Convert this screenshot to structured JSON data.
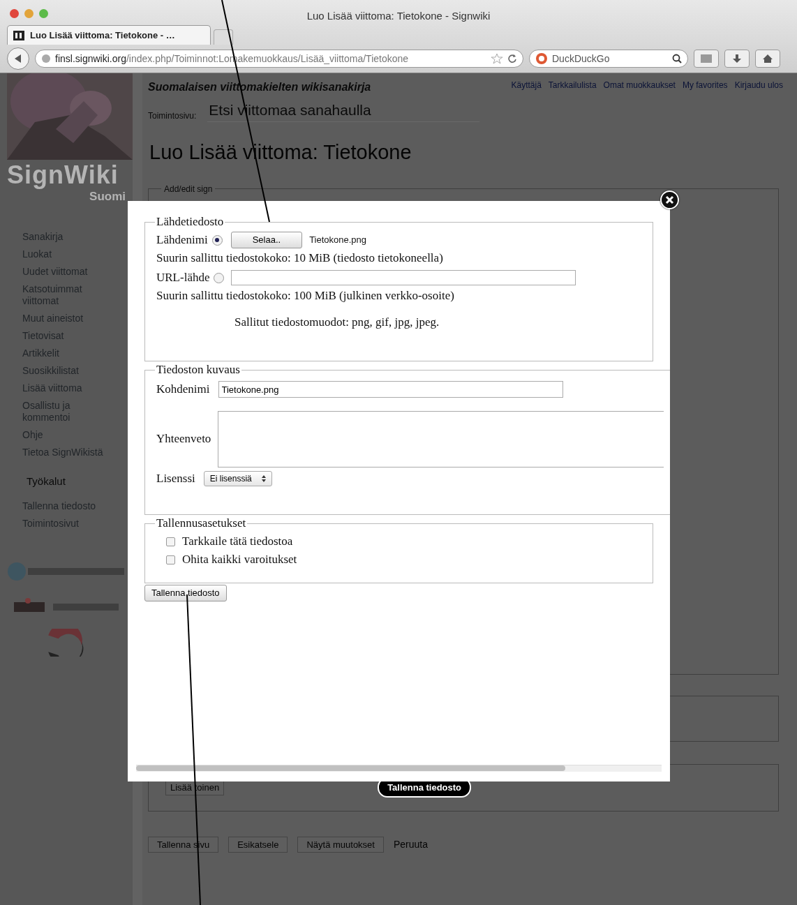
{
  "window": {
    "title": "Luo Lisää viittoma: Tietokone - Signwiki"
  },
  "tabs": [
    {
      "label": "Luo Lisää viittoma: Tietokone - …",
      "selected": true
    }
  ],
  "address_bar": {
    "domain": "finsl.signwiki.org",
    "path": "/index.php/Toiminnot:Lomakemuokkaus/Lisää_viittoma/Tietokone"
  },
  "search_bar": {
    "placeholder": "DuckDuckGo"
  },
  "site": {
    "logo_text": "SignWiki",
    "logo_subtext": "Suomi",
    "tagline": "Suomalaisen viittomakielten wikisanakirja",
    "user_links": [
      "Käyttäjä",
      "Tarkkailulista",
      "Omat muokkaukset",
      "My favorites",
      "Kirjaudu ulos"
    ],
    "search_label": "Toimintosivu:",
    "search_placeholder": "Etsi viittomaa sanahaulla"
  },
  "sidebar": {
    "items": [
      "Sanakirja",
      "Luokat",
      "Uudet viittomat",
      "Katsotuimmat viittomat",
      "Muut aineistot",
      "Tietovisat",
      "Artikkelit",
      "Suosikkilistat",
      "Lisää viittoma",
      "Osallistu ja kommentoi",
      "Ohje",
      "Tietoa SignWikistä"
    ],
    "tools_heading": "Työkalut",
    "tools": [
      "Tallenna tiedosto",
      "Toimintosivut"
    ]
  },
  "page": {
    "heading": "Luo Lisää viittoma: Tietokone",
    "fieldset_legend": "Add/edit sign",
    "add_button": "Lisää toinen",
    "upload_button": "Tallenna tiedosto",
    "actions": [
      "Tallenna sivu",
      "Esikatsele",
      "Näytä muutokset"
    ],
    "cancel_link": "Peruuta"
  },
  "dialog": {
    "source": {
      "legend": "Lähdetiedosto",
      "options": [
        {
          "label": "Lähdenimi",
          "selected": true,
          "kind": "file",
          "button": "Selaa..",
          "file": "Tietokone.png",
          "note": "Suurin sallittu tiedostokoko: 10 MiB (tiedosto tietokoneella)"
        },
        {
          "label": "URL-lähde",
          "selected": false,
          "kind": "url",
          "note": "Suurin sallittu tiedostokoko: 100 MiB (julkinen verkko-osoite)"
        }
      ],
      "formats": "Sallitut tiedostomuodot: png, gif, jpg, jpeg."
    },
    "description": {
      "legend": "Tiedoston kuvaus",
      "target_label": "Kohdenimi",
      "target_value": "Tietokone.png",
      "summary_label": "Yhteenveto",
      "license_label": "Lisenssi",
      "license_value": "Ei lisenssiä"
    },
    "options": {
      "legend": "Tallennusasetukset",
      "checkboxes": [
        {
          "label": "Tarkkaile tätä tiedostoa",
          "checked": false
        },
        {
          "label": "Ohita kaikki varoitukset",
          "checked": false
        }
      ]
    },
    "submit": "Tallenna tiedosto"
  }
}
